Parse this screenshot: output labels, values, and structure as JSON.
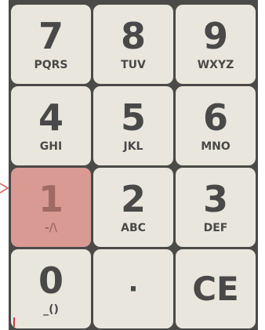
{
  "keypad": {
    "keys": [
      {
        "digit": "7",
        "letters": "PQRS"
      },
      {
        "digit": "8",
        "letters": "TUV"
      },
      {
        "digit": "9",
        "letters": "WXYZ"
      },
      {
        "digit": "4",
        "letters": "GHI"
      },
      {
        "digit": "5",
        "letters": "JKL"
      },
      {
        "digit": "6",
        "letters": "MNO"
      },
      {
        "digit": "1",
        "letters": "-/\\"
      },
      {
        "digit": "2",
        "letters": "ABC"
      },
      {
        "digit": "3",
        "letters": "DEF"
      },
      {
        "digit": "0",
        "letters": "_()"
      },
      {
        "symbol": "·"
      },
      {
        "symbol": "CE"
      }
    ],
    "highlighted_key": "1",
    "colors": {
      "key_background": "#e9e7dd",
      "key_highlight": "#d89a93",
      "gap_background": "#4a4a48",
      "text": "#494949"
    }
  },
  "pointer": {
    "icon": "arrow-right-icon"
  }
}
